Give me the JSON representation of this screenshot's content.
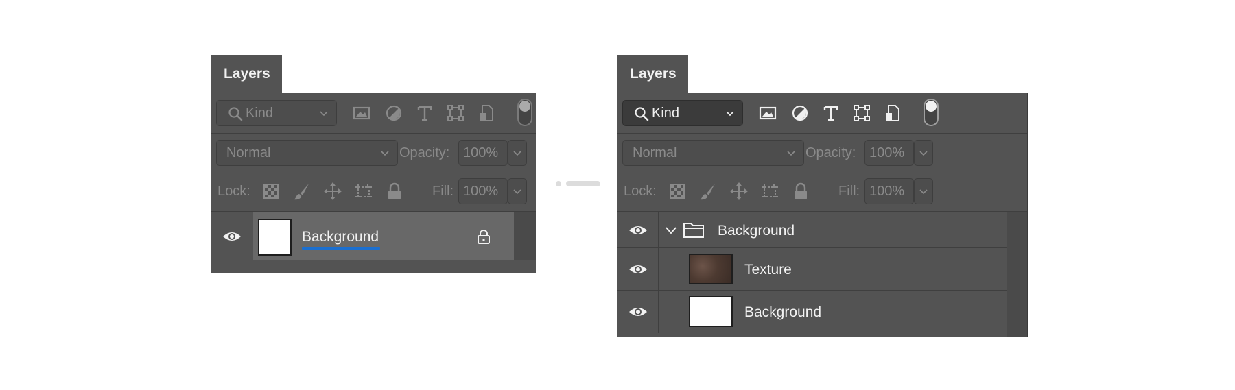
{
  "before": {
    "tab_label": "Layers",
    "filter_placeholder": "Kind",
    "blend_mode": "Normal",
    "opacity_label": "Opacity:",
    "opacity_value": "100%",
    "lock_label": "Lock:",
    "fill_label": "Fill:",
    "fill_value": "100%",
    "layers": [
      {
        "name": "Background",
        "thumbnail": "white",
        "visible": true,
        "locked": true,
        "selected": true
      }
    ]
  },
  "after": {
    "tab_label": "Layers",
    "filter_placeholder": "Kind",
    "blend_mode": "Normal",
    "opacity_label": "Opacity:",
    "opacity_value": "100%",
    "lock_label": "Lock:",
    "fill_label": "Fill:",
    "fill_value": "100%",
    "layers": [
      {
        "name": "Background",
        "type": "group",
        "expanded": true,
        "visible": true
      },
      {
        "name": "Texture",
        "thumbnail": "texture",
        "visible": true
      },
      {
        "name": "Background",
        "thumbnail": "white",
        "visible": true
      }
    ]
  },
  "icons": {
    "filter": [
      "search-icon",
      "pixel-layer-filter-icon",
      "adjustment-layer-filter-icon",
      "type-layer-filter-icon",
      "shape-layer-filter-icon",
      "smart-object-filter-icon"
    ],
    "lock": [
      "lock-transparent-pixels-icon",
      "lock-image-pixels-icon",
      "lock-position-icon",
      "lock-artboard-icon",
      "lock-all-icon"
    ],
    "misc": [
      "eye-icon",
      "layer-lock-icon",
      "chevron-down-icon",
      "folder-icon",
      "arrow-connector-icon"
    ]
  },
  "colors": {
    "panel_bg": "#535353",
    "selected_row": "#686868",
    "rename_underline": "#1b6fd0",
    "page_bg": "#ffffff"
  }
}
